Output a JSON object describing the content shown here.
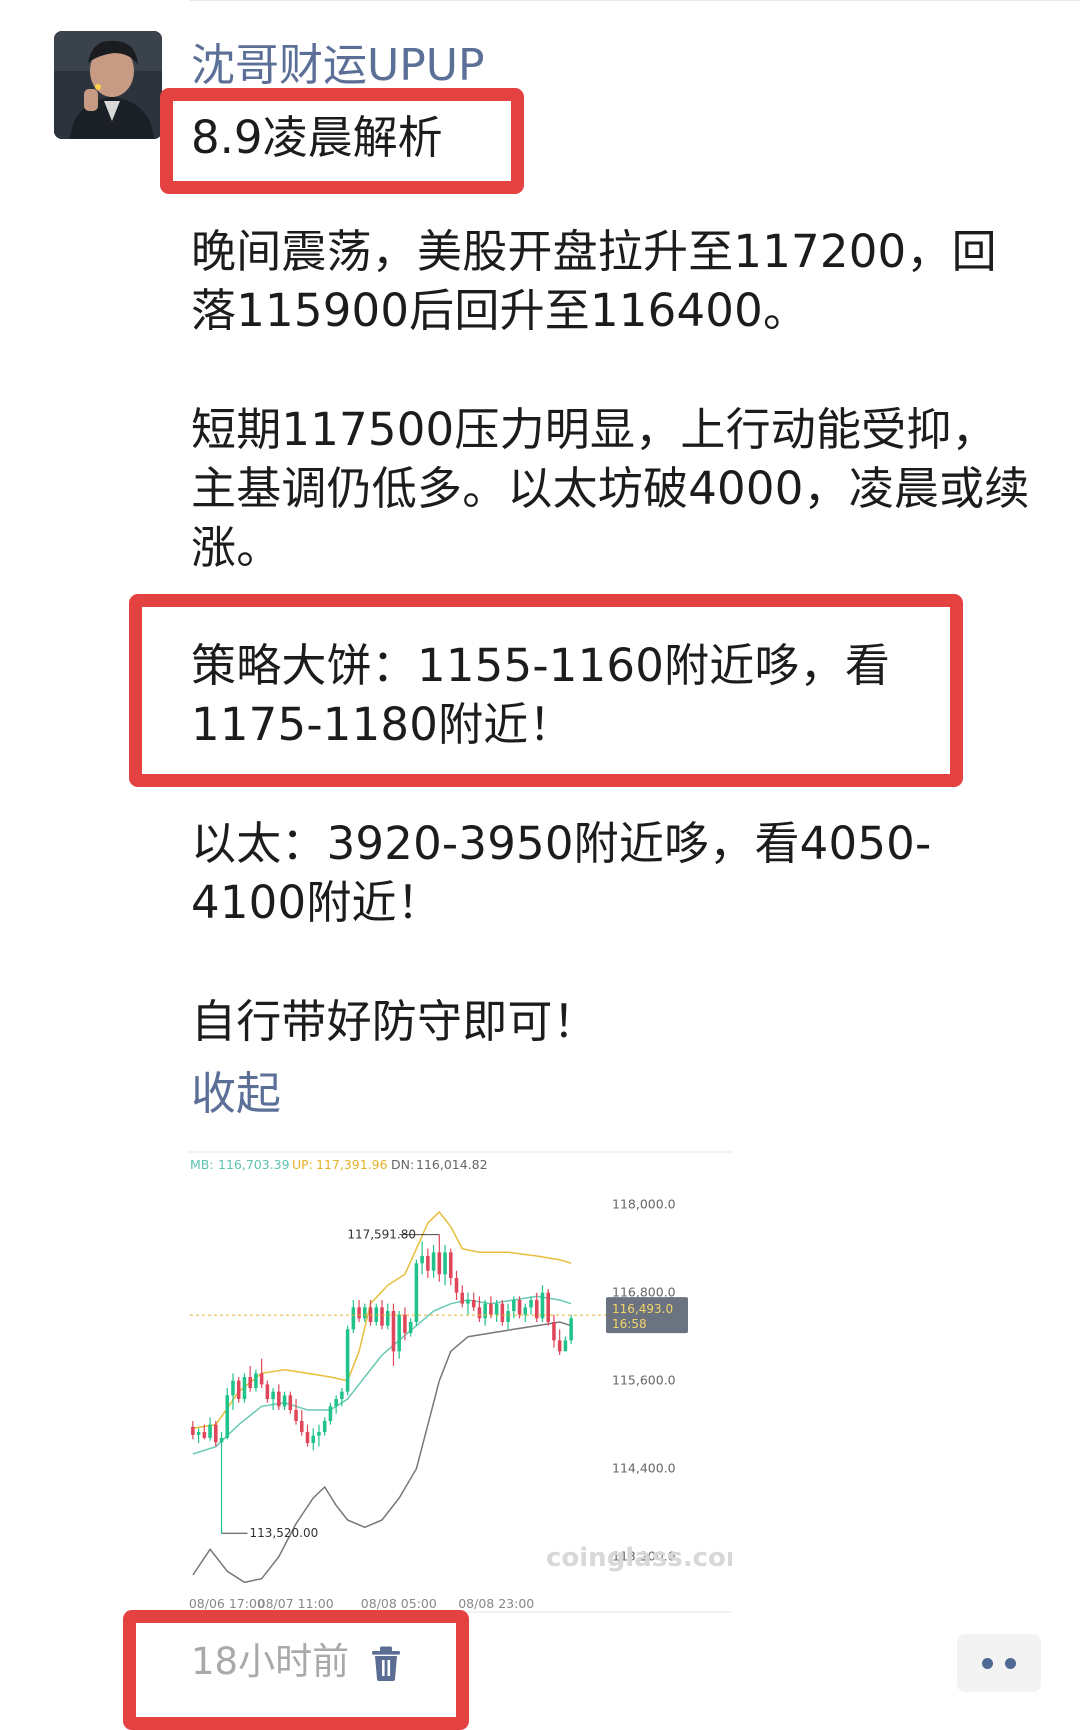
{
  "post": {
    "username": "沈哥财运UPUP",
    "title": "8.9凌晨解析",
    "paragraphs": [
      "晚间震荡，美股开盘拉升至117200，回落115900后回升至116400。",
      "短期117500压力明显，上行动能受抑，主基调仍低多。以太坊破4000，凌晨或续涨。",
      "策略大饼：1155-1160附近哆，看1175-1180附近！",
      "以太：3920-3950附近哆，看4050-4100附近！",
      "自行带好防守即可！"
    ],
    "collapse_label": "收起",
    "timestamp": "18小时前",
    "icons": {
      "delete": "trash-icon",
      "more": "more-dots-icon",
      "avatar": "avatar-photo"
    },
    "colors": {
      "name_link": "#5c6f97",
      "highlight_box": "#e34241",
      "timestamp": "#a9a9a9"
    }
  },
  "chart_data": {
    "type": "candlestick",
    "indicators": {
      "mb_label": "MB:",
      "mb_value": "116,703.39",
      "up_label": "UP:",
      "up_value": "117,391.96",
      "dn_label": "DN:",
      "dn_value": "116,014.82"
    },
    "y_ticks": [
      "118,000.0",
      "116,800.0",
      "115,600.0",
      "114,400.0",
      "113,200.0"
    ],
    "y_tick_values": [
      118000,
      116800,
      115600,
      114400,
      113200
    ],
    "ylim": [
      112800,
      118500
    ],
    "x_labels": [
      "08/06 17:00",
      "08/07 11:00",
      "08/08 05:00",
      "08/08 23:00"
    ],
    "current_price": "116,493.0",
    "current_time": "16:58",
    "current_value": 116493,
    "high_label": "117,591.80",
    "high_value": 117591.8,
    "low_label": "113,520.00",
    "low_value": 113520,
    "watermark": "coinglass.com",
    "candles": [
      [
        114970,
        115050,
        114800,
        114860
      ],
      [
        114860,
        114950,
        114750,
        114900
      ],
      [
        114900,
        115000,
        114800,
        114820
      ],
      [
        114820,
        115100,
        114780,
        115000
      ],
      [
        115000,
        115050,
        114700,
        114760
      ],
      [
        114760,
        114900,
        113520,
        114820
      ],
      [
        114820,
        115500,
        114800,
        115400
      ],
      [
        115400,
        115700,
        115200,
        115600
      ],
      [
        115600,
        115650,
        115300,
        115350
      ],
      [
        115350,
        115700,
        115300,
        115650
      ],
      [
        115650,
        115800,
        115450,
        115500
      ],
      [
        115500,
        115750,
        115450,
        115700
      ],
      [
        115700,
        115900,
        115500,
        115550
      ],
      [
        115550,
        115600,
        115300,
        115350
      ],
      [
        115350,
        115500,
        115200,
        115450
      ],
      [
        115450,
        115550,
        115200,
        115250
      ],
      [
        115250,
        115450,
        115200,
        115400
      ],
      [
        115400,
        115450,
        115150,
        115200
      ],
      [
        115200,
        115350,
        115000,
        115050
      ],
      [
        115050,
        115200,
        114850,
        114900
      ],
      [
        114900,
        115000,
        114700,
        114750
      ],
      [
        114750,
        114950,
        114650,
        114850
      ],
      [
        114850,
        115000,
        114700,
        114900
      ],
      [
        114900,
        115100,
        114850,
        115050
      ],
      [
        115050,
        115300,
        115000,
        115250
      ],
      [
        115250,
        115400,
        115150,
        115350
      ],
      [
        115350,
        115500,
        115250,
        115450
      ],
      [
        115450,
        116350,
        115400,
        116300
      ],
      [
        116300,
        116700,
        116250,
        116600
      ],
      [
        116600,
        116700,
        116400,
        116450
      ],
      [
        116450,
        116650,
        116400,
        116600
      ],
      [
        116600,
        116700,
        116350,
        116400
      ],
      [
        116400,
        116650,
        116350,
        116600
      ],
      [
        116600,
        116700,
        116300,
        116350
      ],
      [
        116350,
        116650,
        116300,
        116550
      ],
      [
        116550,
        116650,
        115800,
        116000
      ],
      [
        116000,
        116550,
        115900,
        116500
      ],
      [
        116500,
        116600,
        116150,
        116250
      ],
      [
        116250,
        116450,
        116200,
        116400
      ],
      [
        116400,
        117250,
        116350,
        117200
      ],
      [
        117200,
        117500,
        117050,
        117300
      ],
      [
        117300,
        117400,
        117000,
        117100
      ],
      [
        117100,
        117450,
        117000,
        117350
      ],
      [
        117350,
        117591,
        116950,
        117050
      ],
      [
        117050,
        117450,
        116900,
        117350
      ],
      [
        117350,
        117400,
        116900,
        117000
      ],
      [
        117000,
        117100,
        116700,
        116800
      ],
      [
        116800,
        116900,
        116600,
        116650
      ],
      [
        116650,
        116800,
        116500,
        116700
      ],
      [
        116700,
        116800,
        116550,
        116600
      ],
      [
        116600,
        116750,
        116400,
        116450
      ],
      [
        116450,
        116700,
        116350,
        116650
      ],
      [
        116650,
        116750,
        116450,
        116500
      ],
      [
        116500,
        116700,
        116400,
        116650
      ],
      [
        116650,
        116700,
        116350,
        116400
      ],
      [
        116400,
        116650,
        116300,
        116550
      ],
      [
        116550,
        116750,
        116450,
        116700
      ],
      [
        116700,
        116750,
        116450,
        116500
      ],
      [
        116500,
        116650,
        116400,
        116600
      ],
      [
        116600,
        116750,
        116500,
        116700
      ],
      [
        116700,
        116800,
        116400,
        116450
      ],
      [
        116450,
        116900,
        116400,
        116800
      ],
      [
        116800,
        116850,
        116350,
        116400
      ],
      [
        116400,
        116500,
        116050,
        116150
      ],
      [
        116150,
        116300,
        115950,
        116000
      ],
      [
        116000,
        116200,
        116050,
        116150
      ],
      [
        116150,
        116500,
        116100,
        116450
      ]
    ],
    "upper_band": [
      [
        0,
        114950
      ],
      [
        4,
        115000
      ],
      [
        8,
        115450
      ],
      [
        12,
        115700
      ],
      [
        16,
        115750
      ],
      [
        20,
        115700
      ],
      [
        24,
        115650
      ],
      [
        27,
        115600
      ],
      [
        29,
        116000
      ],
      [
        31,
        116650
      ],
      [
        34,
        116900
      ],
      [
        37,
        117050
      ],
      [
        39,
        117400
      ],
      [
        41,
        117750
      ],
      [
        43,
        117900
      ],
      [
        45,
        117700
      ],
      [
        47,
        117400
      ],
      [
        50,
        117350
      ],
      [
        55,
        117350
      ],
      [
        60,
        117300
      ],
      [
        64,
        117250
      ],
      [
        66,
        117200
      ]
    ],
    "middle_band": [
      [
        0,
        114600
      ],
      [
        4,
        114700
      ],
      [
        8,
        115000
      ],
      [
        12,
        115250
      ],
      [
        16,
        115300
      ],
      [
        20,
        115200
      ],
      [
        24,
        115200
      ],
      [
        27,
        115350
      ],
      [
        30,
        115650
      ],
      [
        33,
        115950
      ],
      [
        36,
        116150
      ],
      [
        39,
        116350
      ],
      [
        42,
        116550
      ],
      [
        45,
        116650
      ],
      [
        48,
        116700
      ],
      [
        52,
        116650
      ],
      [
        56,
        116700
      ],
      [
        60,
        116750
      ],
      [
        64,
        116700
      ],
      [
        66,
        116650
      ]
    ],
    "lower_band": [
      [
        0,
        112950
      ],
      [
        3,
        113300
      ],
      [
        6,
        113000
      ],
      [
        9,
        112850
      ],
      [
        12,
        112900
      ],
      [
        15,
        113200
      ],
      [
        18,
        113650
      ],
      [
        21,
        114000
      ],
      [
        23,
        114150
      ],
      [
        25,
        113900
      ],
      [
        27,
        113700
      ],
      [
        30,
        113600
      ],
      [
        33,
        113700
      ],
      [
        36,
        114000
      ],
      [
        39,
        114400
      ],
      [
        41,
        115000
      ],
      [
        43,
        115600
      ],
      [
        45,
        116000
      ],
      [
        48,
        116200
      ],
      [
        52,
        116250
      ],
      [
        56,
        116300
      ],
      [
        60,
        116350
      ],
      [
        64,
        116400
      ],
      [
        66,
        116350
      ]
    ]
  }
}
